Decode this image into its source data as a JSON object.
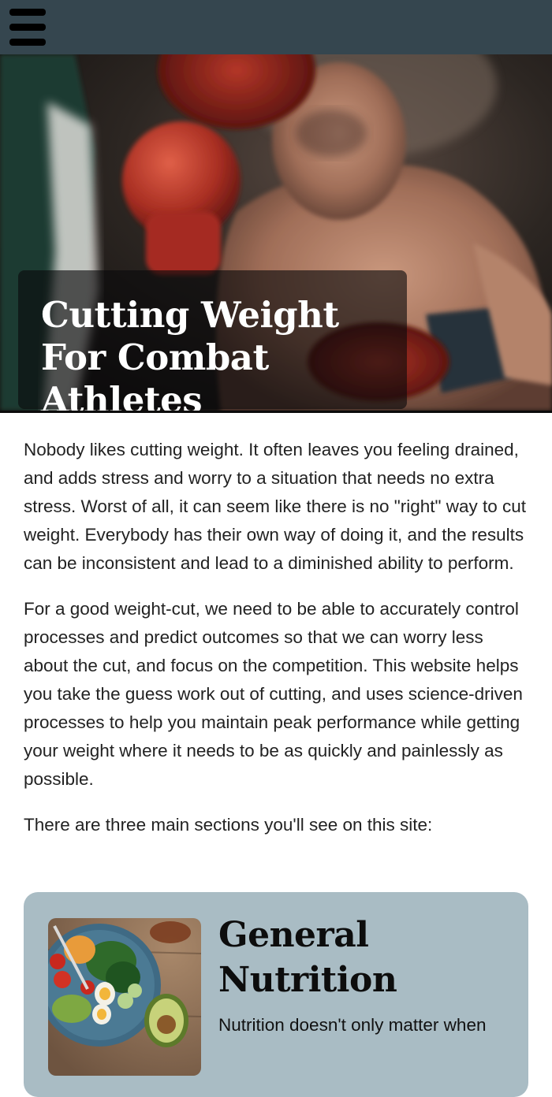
{
  "nav": {
    "menu_icon": "hamburger-menu-icon",
    "bar_color": "#35464f"
  },
  "hero": {
    "title": "Cutting Weight For Combat Athletes",
    "image_description_icon": "boxer-photo"
  },
  "intro": {
    "paragraphs": [
      "Nobody likes cutting weight. It often leaves you feeling drained, and adds stress and worry to a situation that needs no extra stress. Worst of all, it can seem like there is no \"right\" way to cut weight. Everybody has their own way of doing it, and the results can be inconsistent and lead to a diminished ability to perform.",
      "For a good weight-cut, we need to be able to accurately control processes and predict outcomes so that we can worry less about the cut, and focus on the competition. This website helps you take the guess work out of cutting, and uses science-driven processes to help you maintain peak performance while getting your weight where it needs to be as quickly and painlessly as possible.",
      "There are three main sections you'll see on this site:"
    ]
  },
  "sections": [
    {
      "title": "General Nutrition",
      "text": "Nutrition doesn't only matter when",
      "image_icon": "food-bowl-photo",
      "card_color": "#a9bcc4"
    }
  ]
}
